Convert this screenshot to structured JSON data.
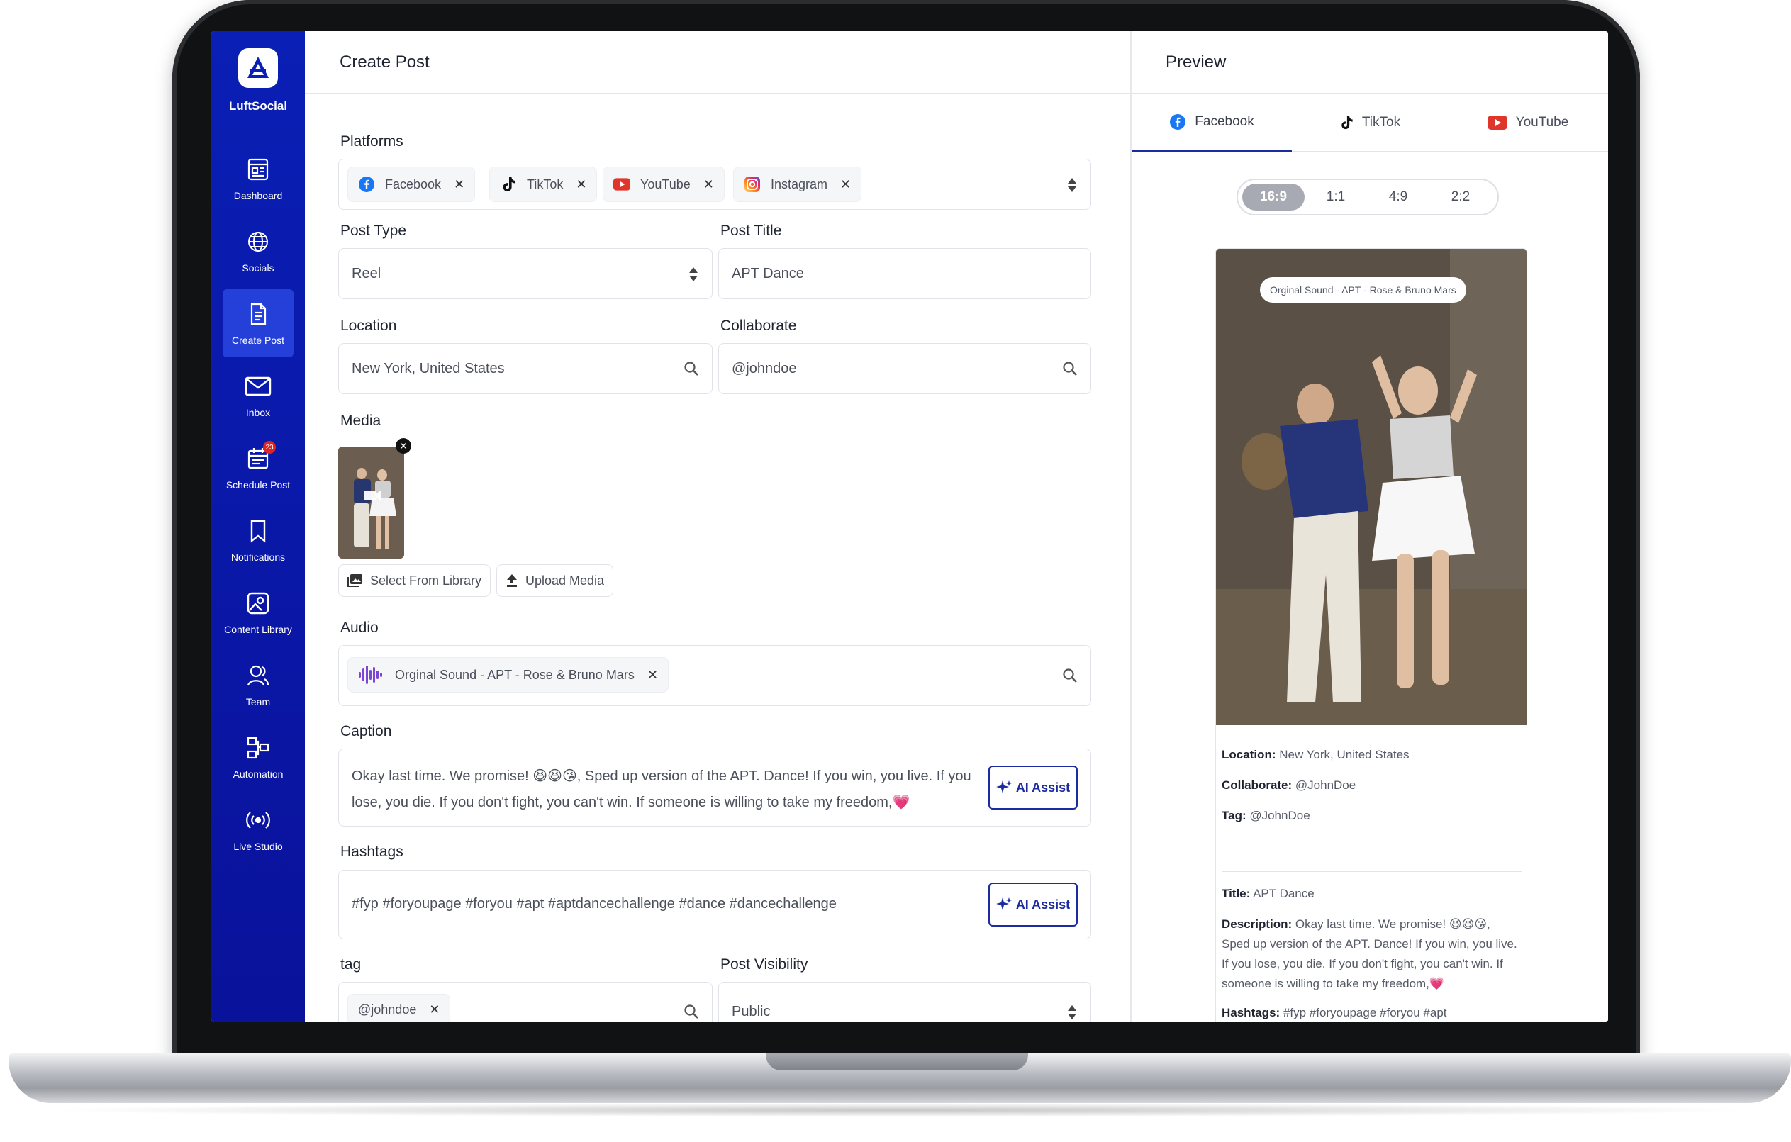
{
  "app": {
    "name": "LuftSocial"
  },
  "sidebar": {
    "items": [
      {
        "label": "Dashboard",
        "icon": "dashboard-icon"
      },
      {
        "label": "Socials",
        "icon": "globe-icon"
      },
      {
        "label": "Create Post",
        "icon": "document-icon",
        "active": true
      },
      {
        "label": "Inbox",
        "icon": "mail-icon"
      },
      {
        "label": "Schedule Post",
        "icon": "calendar-icon",
        "badge": "23"
      },
      {
        "label": "Notifications",
        "icon": "bookmark-icon"
      },
      {
        "label": "Content Library",
        "icon": "image-icon"
      },
      {
        "label": "Team",
        "icon": "team-icon"
      },
      {
        "label": "Automation",
        "icon": "automation-icon"
      },
      {
        "label": "Live Studio",
        "icon": "broadcast-icon"
      }
    ]
  },
  "main": {
    "title": "Create Post",
    "platforms": {
      "label": "Platforms",
      "chips": [
        "Facebook",
        "TikTok",
        "YouTube",
        "Instagram"
      ]
    },
    "post_type": {
      "label": "Post Type",
      "value": "Reel"
    },
    "post_title": {
      "label": "Post Title",
      "value": "APT Dance"
    },
    "location": {
      "label": "Location",
      "value": "New York, United States"
    },
    "collaborate": {
      "label": "Collaborate",
      "value": "@johndoe"
    },
    "media": {
      "label": "Media",
      "select_from_library": "Select From Library",
      "upload_media": "Upload Media"
    },
    "audio": {
      "label": "Audio",
      "chip": "Orginal Sound - APT - Rose & Bruno Mars"
    },
    "caption": {
      "label": "Caption",
      "text": "Okay last time. We promise! 😆😆😘, Sped up version of the APT. Dance!  If you win, you live. If you lose, you die. If you don't fight, you can't win. If someone is willing to take my freedom,💗",
      "ai_assist": "AI Assist"
    },
    "hashtags": {
      "label": "Hashtags",
      "text": "#fyp #foryoupage #foryou #apt #aptdancechallenge #dance #dancechallenge",
      "ai_assist": "AI Assist"
    },
    "tag": {
      "label": "tag",
      "chip": "@johndoe"
    },
    "visibility": {
      "label": "Post Visibility",
      "value": "Public"
    }
  },
  "preview": {
    "title": "Preview",
    "tabs": [
      "Facebook",
      "TikTok",
      "YouTube"
    ],
    "ratios": [
      "16:9",
      "1:1",
      "4:9",
      "2:2"
    ],
    "audio_pill": "Orginal Sound - APT - Rose & Bruno Mars",
    "location_label": "Location:",
    "location_value": " New York, United States",
    "collaborate_label": "Collaborate:",
    "collaborate_value": " @JohnDoe",
    "tag_label": "Tag:",
    "tag_value": " @JohnDoe",
    "title_label": "Title:",
    "title_value": " APT Dance",
    "description_label": "Description:",
    "description_value": " Okay last time. We promise! 😆😆😘, Sped up version of the APT. Dance!  If you win, you live. If you lose, you die. If you don't fight, you can't win. If someone is willing to take my freedom,💗",
    "hashtags_label": "Hashtags:",
    "hashtags_value": " #fyp #foryoupage #foryou #apt #aptdancechallenge #dance #dancechallenge"
  },
  "colors": {
    "sidebar": "#0a1fb5",
    "accent": "#1c2ba0",
    "facebook": "#1877f2",
    "youtube": "#e0352b",
    "instagram": "#d6249f"
  }
}
